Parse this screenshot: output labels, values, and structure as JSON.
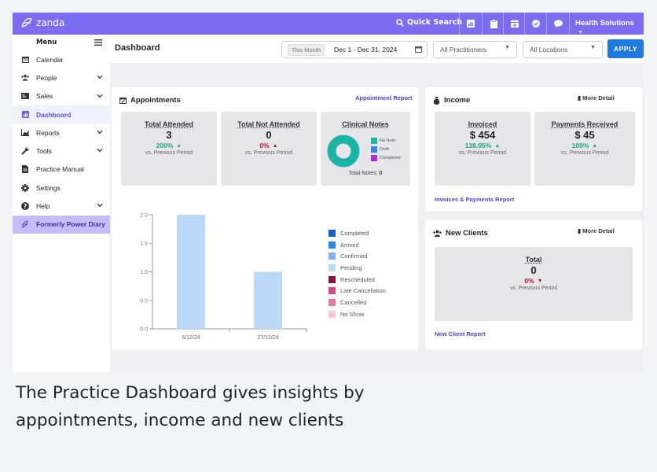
{
  "topbar": {
    "logo": "zanda",
    "quick_search": "Quick Search",
    "org": "Health Solutions"
  },
  "sidebar": {
    "menu_label": "Menu",
    "items": [
      {
        "label": "Calendar",
        "icon": "calendar-icon"
      },
      {
        "label": "People",
        "icon": "people-icon"
      },
      {
        "label": "Sales",
        "icon": "sales-icon"
      },
      {
        "label": "Dashboard",
        "icon": "dashboard-icon"
      },
      {
        "label": "Reports",
        "icon": "reports-icon"
      },
      {
        "label": "Tools",
        "icon": "wrench-icon"
      },
      {
        "label": "Practice Manual",
        "icon": "document-icon"
      },
      {
        "label": "Settings",
        "icon": "gear-icon"
      },
      {
        "label": "Help",
        "icon": "help-icon"
      },
      {
        "label": "Formerly Power Diary",
        "icon": "power-diary-icon"
      }
    ]
  },
  "header": {
    "title": "Dashboard",
    "this_month": "This Month",
    "date_range": "Dec 1 - Dec 31, 2024",
    "practitioners": "All Practitioners",
    "locations": "All Locations",
    "apply": "APPLY"
  },
  "appointments": {
    "title": "Appointments",
    "report_link": "Appointment Report",
    "total_attended": {
      "label": "Total Attended",
      "value": "3",
      "change": "200%",
      "direction": "up",
      "sub": "vs. Previous Period"
    },
    "total_not_attended": {
      "label": "Total Not Attended",
      "value": "0",
      "change": "0%",
      "direction": "up",
      "sub": "vs. Previous Period"
    },
    "clinical_notes": {
      "label": "Clinical Notes",
      "legend": [
        "No Note",
        "Draft",
        "Completed"
      ],
      "total_label": "Total Notes:",
      "total_value": "0"
    }
  },
  "income": {
    "title": "Income",
    "more": "More Detail",
    "invoiced": {
      "label": "Invoiced",
      "value": "$ 454",
      "change": "138.95%",
      "direction": "up",
      "sub": "vs. Previous Period"
    },
    "payments": {
      "label": "Payments Received",
      "value": "$ 45",
      "change": "100%",
      "direction": "up",
      "sub": "vs. Previous Period"
    },
    "report_link": "Invoices & Payments Report"
  },
  "new_clients": {
    "title": "New Clients",
    "more": "More Detail",
    "total": {
      "label": "Total",
      "value": "0",
      "change": "0%",
      "direction": "down",
      "sub": "vs. Previous Period"
    },
    "report_link": "New Client Report"
  },
  "chart_data": {
    "type": "bar",
    "categories": [
      "6/12/24",
      "27/12/24"
    ],
    "series": [
      {
        "name": "Completed",
        "color": "#1565c0",
        "values": [
          0,
          0
        ]
      },
      {
        "name": "Arrived",
        "color": "#2f86e8",
        "values": [
          0,
          0
        ]
      },
      {
        "name": "Confirmed",
        "color": "#7fb5ea",
        "values": [
          0,
          0
        ]
      },
      {
        "name": "Pending",
        "color": "#bcd8f7",
        "values": [
          2,
          1
        ]
      },
      {
        "name": "Rescheduled",
        "color": "#8c1044",
        "values": [
          0,
          0
        ]
      },
      {
        "name": "Late Cancellation",
        "color": "#d0498a",
        "values": [
          0,
          0
        ]
      },
      {
        "name": "Cancelled",
        "color": "#e07aa8",
        "values": [
          0,
          0
        ]
      },
      {
        "name": "No Show",
        "color": "#f2cadb",
        "values": [
          0,
          0
        ]
      }
    ],
    "yticks": [
      "0.0",
      "0.5",
      "1.0",
      "1.5",
      "2.0"
    ],
    "ylim": [
      0,
      2
    ]
  },
  "caption": {
    "line1": "The Practice Dashboard gives insights by",
    "line2": "appointments, income and new clients"
  }
}
